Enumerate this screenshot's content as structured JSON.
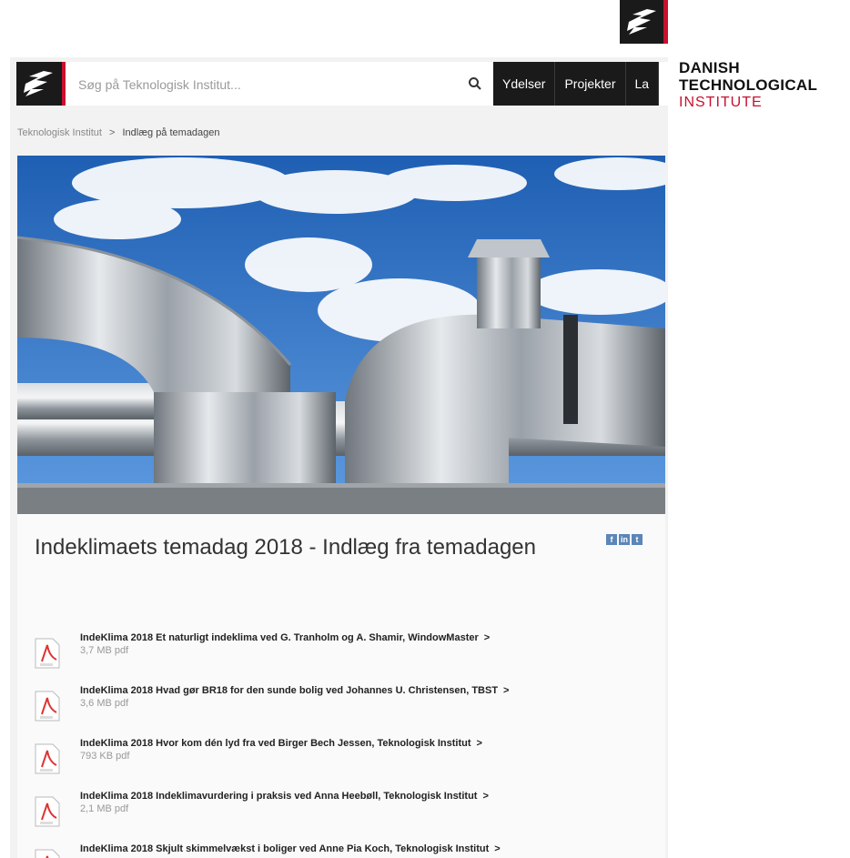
{
  "brand": {
    "line1": "DANISH",
    "line2": "TECHNOLOGICAL",
    "line3": "INSTITUTE"
  },
  "search": {
    "placeholder": "Søg på Teknologisk Institut..."
  },
  "nav": {
    "items": [
      "Ydelser",
      "Projekter",
      "La"
    ]
  },
  "breadcrumb": {
    "root": "Teknologisk Institut",
    "separator": ">",
    "current": "Indlæg på temadagen"
  },
  "page": {
    "title": "Indeklimaets temadag 2018 - Indlæg fra temadagen"
  },
  "share": {
    "facebook": "f",
    "linkedin": "in",
    "twitter": "t"
  },
  "documents": [
    {
      "title": "IndeKlima 2018 Et naturligt indeklima ved G. Tranholm og A. Shamir, WindowMaster",
      "arrow": ">",
      "size": "3,7 MB pdf"
    },
    {
      "title": "IndeKlima 2018 Hvad gør BR18 for den sunde bolig ved Johannes U. Christensen, TBST",
      "arrow": ">",
      "size": "3,6 MB pdf"
    },
    {
      "title": "IndeKlima 2018 Hvor kom dén lyd fra ved Birger Bech Jessen, Teknologisk Institut",
      "arrow": ">",
      "size": "793 KB pdf"
    },
    {
      "title": "IndeKlima 2018 Indeklimavurdering i praksis ved Anna Heebøll, Teknologisk Institut",
      "arrow": ">",
      "size": "2,1 MB pdf"
    },
    {
      "title": "IndeKlima 2018 Skjult skimmelvækst i boliger ved Anne Pia Koch, Teknologisk Institut",
      "arrow": ">",
      "size": ""
    }
  ],
  "colors": {
    "brand_red": "#c8102e",
    "nav_dark": "#1a1a1a",
    "sky": "#2f6fc0",
    "share_blue": "#5b86b8"
  }
}
